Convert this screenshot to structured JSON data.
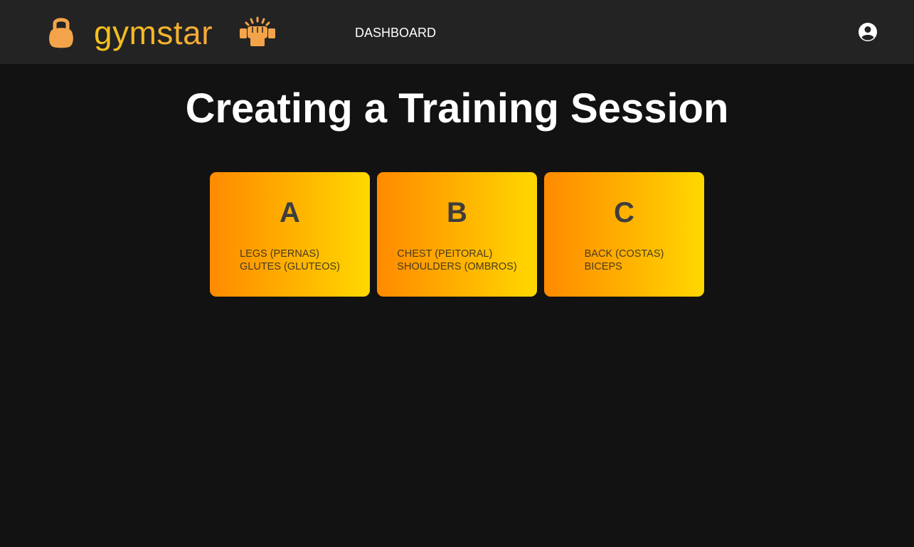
{
  "header": {
    "brand": "gymstar",
    "nav": {
      "dashboard_label": "DASHBOARD"
    },
    "icons": {
      "logo_left": "kettlebell-icon",
      "logo_right": "raised-fist-icon",
      "account": "account-circle-icon"
    },
    "colors": {
      "bar_background": "#232323",
      "brand_gradient_start": "#f6c21a",
      "brand_gradient_end": "#f3a839",
      "icon_orange": "#f3a44a"
    }
  },
  "main": {
    "title": "Creating a Training Session",
    "sessions": [
      {
        "letter": "A",
        "muscles": [
          "LEGS (PERNAS)",
          "GLUTES (GLUTEOS)"
        ]
      },
      {
        "letter": "B",
        "muscles": [
          "CHEST (PEITORAL)",
          "SHOULDERS (OMBROS)"
        ]
      },
      {
        "letter": "C",
        "muscles": [
          "BACK (COSTAS)",
          "BICEPS"
        ]
      }
    ],
    "colors": {
      "page_background": "#121212",
      "card_gradient_start": "#ff8a00",
      "card_gradient_end": "#ffd800",
      "card_text": "#3d3d3d"
    }
  }
}
